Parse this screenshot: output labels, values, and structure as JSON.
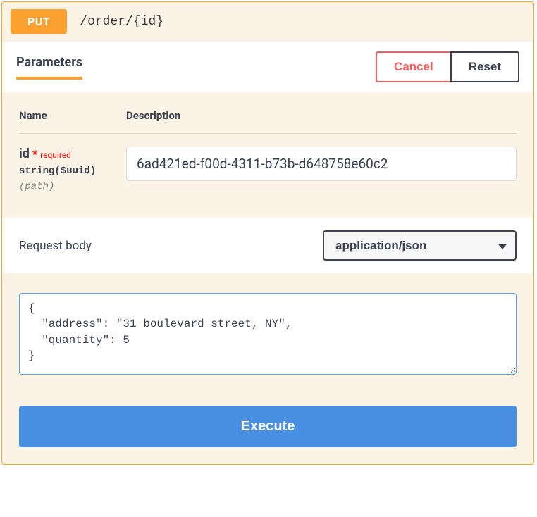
{
  "method": "PUT",
  "path": "/order/{id}",
  "tabs": {
    "parameters": "Parameters"
  },
  "actions": {
    "cancel": "Cancel",
    "reset": "Reset",
    "execute": "Execute"
  },
  "columns": {
    "name": "Name",
    "description": "Description"
  },
  "params": {
    "id": {
      "name": "id",
      "required_star": "*",
      "required_label": "required",
      "type": "string($uuid)",
      "location": "(path)",
      "value": "6ad421ed-f00d-4311-b73b-d648758e60c2"
    }
  },
  "body": {
    "label": "Request body",
    "content_type": "application/json",
    "value": "{\n  \"address\": \"31 boulevard street, NY\",\n  \"quantity\": 5\n}"
  }
}
